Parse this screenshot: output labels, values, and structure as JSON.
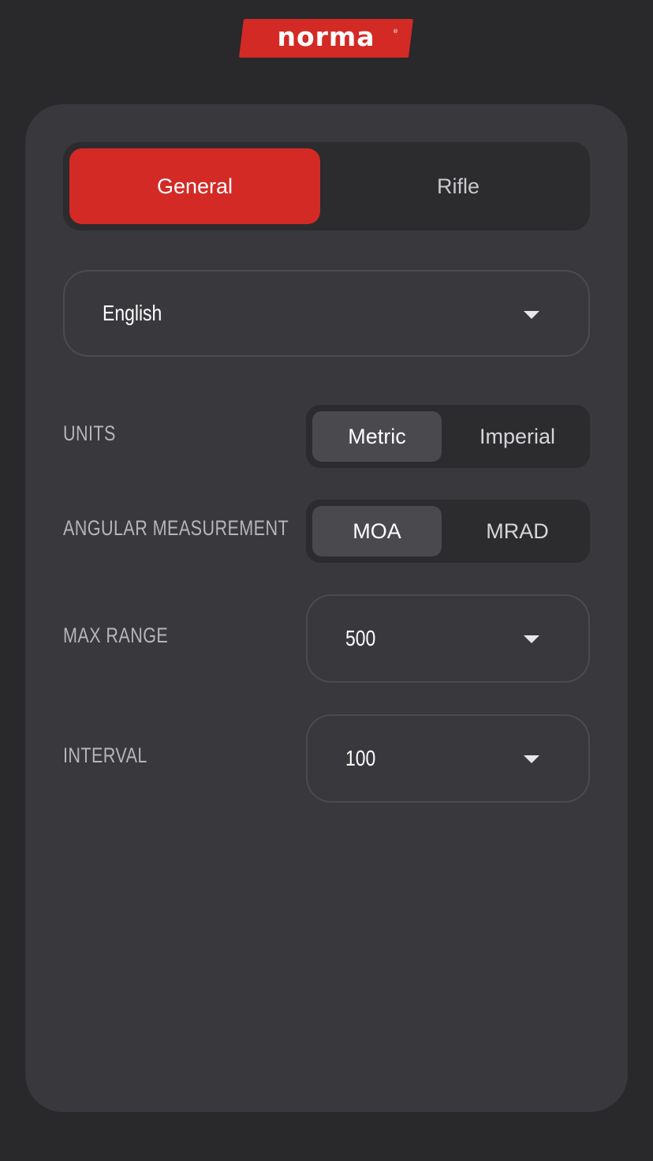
{
  "brand": {
    "logo_text": "norma",
    "registered_mark": "®",
    "color": "#d32a26"
  },
  "tabs": [
    {
      "label": "General",
      "active": true
    },
    {
      "label": "Rifle",
      "active": false
    }
  ],
  "language": {
    "selected": "English",
    "icon": "chevron-down-icon"
  },
  "settings": {
    "units": {
      "label": "UNITS",
      "options": [
        "Metric",
        "Imperial"
      ],
      "selected": "Metric"
    },
    "angular": {
      "label": "ANGULAR MEASUREMENT",
      "options": [
        "MOA",
        "MRAD"
      ],
      "selected": "MOA"
    },
    "max_range": {
      "label": "MAX RANGE",
      "value": "500"
    },
    "interval": {
      "label": "INTERVAL",
      "value": "100"
    }
  }
}
